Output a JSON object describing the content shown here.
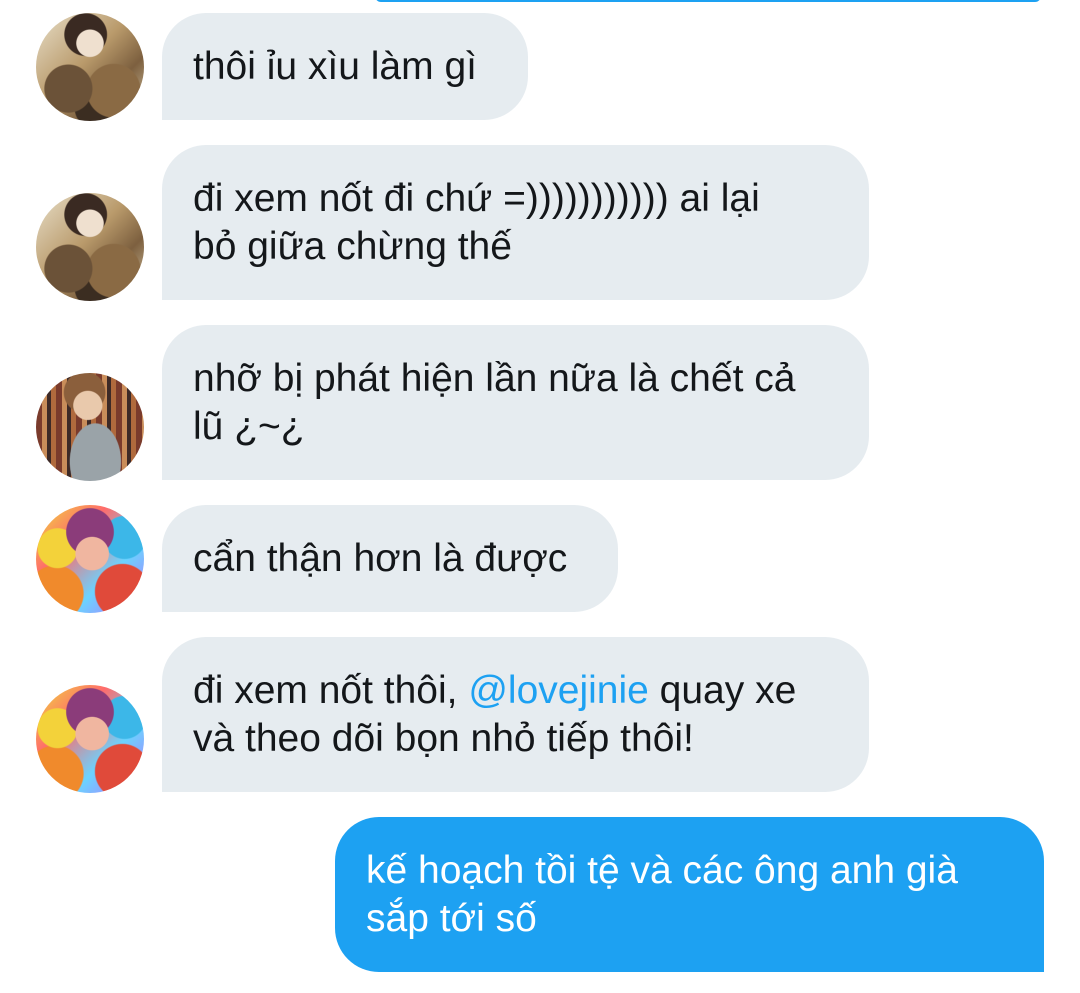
{
  "messages": [
    {
      "text": "thôi ỉu xìu làm gì"
    },
    {
      "text": "đi xem nốt đi chứ =))))))))))) ai lại\nbỏ giữa chừng thế"
    },
    {
      "text": "nhỡ bị phát hiện lần nữa là chết cả\nlũ ¿~¿"
    },
    {
      "text": "cẩn thận hơn là được"
    },
    {
      "text_before": "đi xem nốt thôi, ",
      "mention": "@lovejinie",
      "text_after": " quay xe\nvà theo dõi bọn nhỏ tiếp thôi!"
    },
    {
      "text": "kế hoạch tồi tệ và các ông anh già\nsắp tới số"
    }
  ],
  "colors": {
    "incoming_bubble": "#e6ecf0",
    "outgoing_bubble": "#1da1f2",
    "mention": "#1da1f2",
    "text": "#14171a"
  }
}
